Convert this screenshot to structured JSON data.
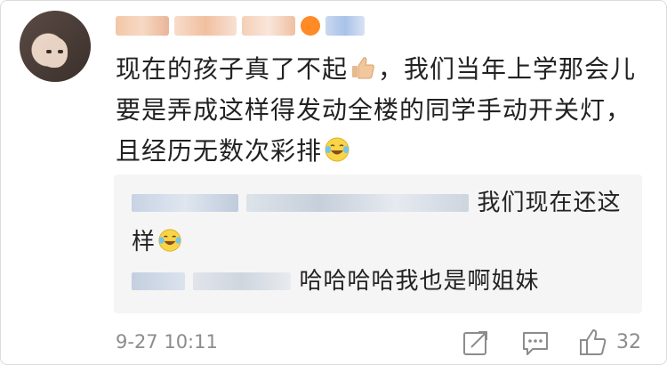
{
  "post": {
    "comment_text_1": "现在的孩子真了不起",
    "comment_text_2": "，我们当年上学那会儿要是弄成这样得发动全楼的同学手动开关灯，且经历无数次彩排",
    "emoji_1": "thumbs-up-icon",
    "emoji_2": "laughing-tears-icon"
  },
  "replies": [
    {
      "text": "我们现在还这样",
      "emoji": "laughing-tears-icon"
    },
    {
      "text": "哈哈哈哈我也是啊姐妹"
    }
  ],
  "footer": {
    "timestamp": "9-27 10:11",
    "like_count": "32",
    "icons": [
      "share-icon",
      "comment-icon",
      "like-icon"
    ]
  },
  "colors": {
    "background": "#ffffff",
    "reply_background": "#f5f5f5",
    "meta_gray": "#8c8c8c",
    "badge_orange": "#ff8a26"
  }
}
